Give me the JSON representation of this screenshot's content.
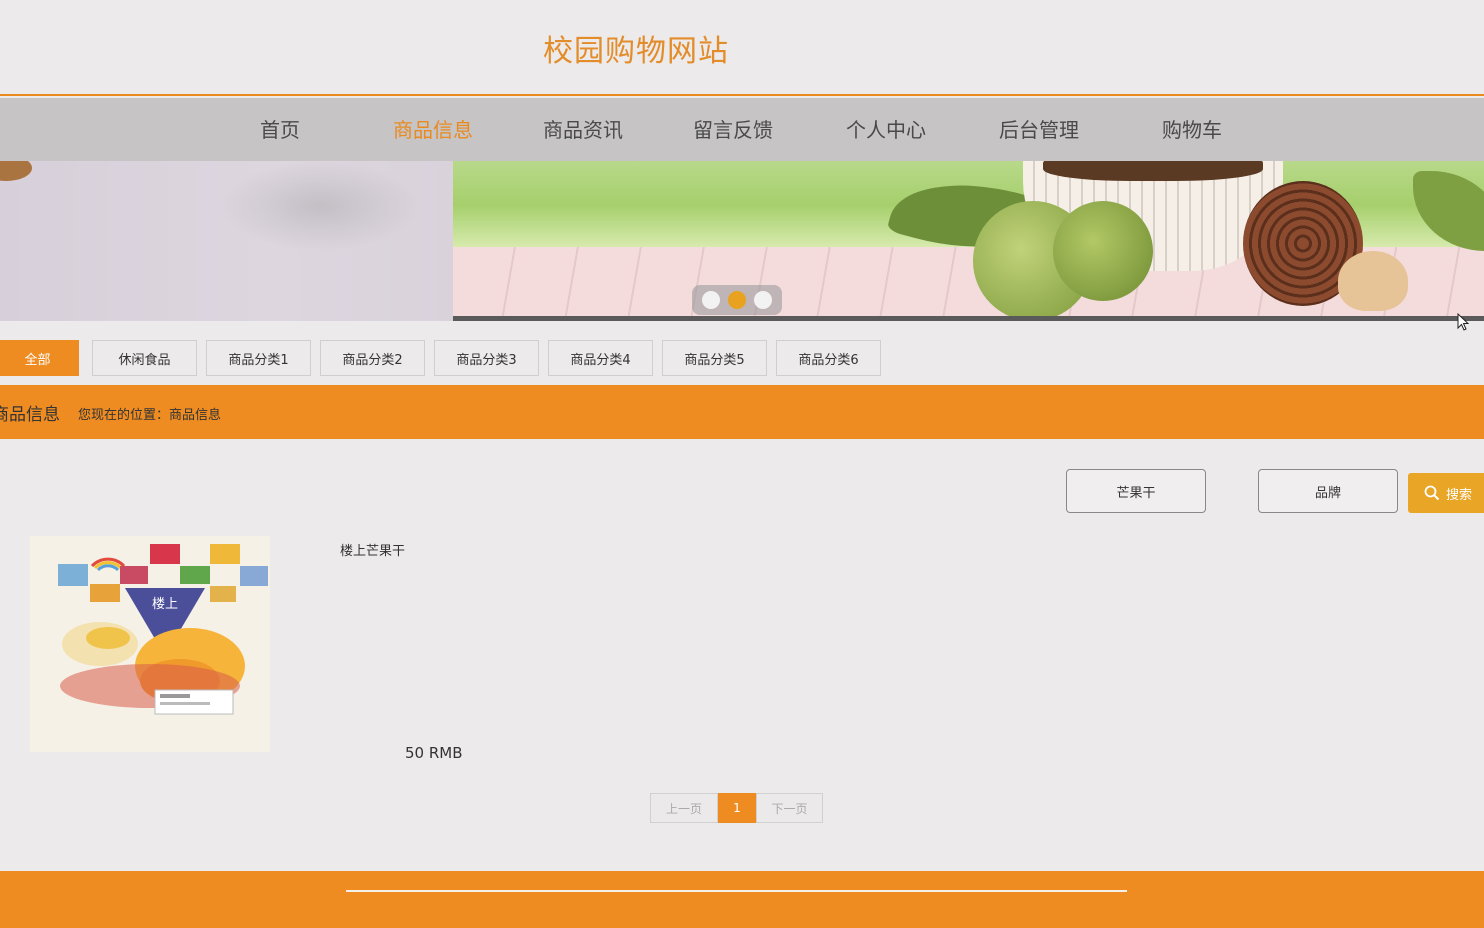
{
  "header": {
    "site_title": "校园购物网站"
  },
  "nav": {
    "items": [
      {
        "label": "首页"
      },
      {
        "label": "商品信息",
        "active": true
      },
      {
        "label": "商品资讯"
      },
      {
        "label": "留言反馈"
      },
      {
        "label": "个人中心"
      },
      {
        "label": "后台管理"
      },
      {
        "label": "购物车"
      }
    ]
  },
  "banner": {
    "dots": 3,
    "active_dot": 2
  },
  "categories": [
    {
      "label": "全部",
      "active": true
    },
    {
      "label": "休闲食品"
    },
    {
      "label": "商品分类1"
    },
    {
      "label": "商品分类2"
    },
    {
      "label": "商品分类3"
    },
    {
      "label": "商品分类4"
    },
    {
      "label": "商品分类5"
    },
    {
      "label": "商品分类6"
    }
  ],
  "crumbbar": {
    "title": "商品信息",
    "path": "您现在的位置：商品信息"
  },
  "search": {
    "name_value": "芒果干",
    "brand_value": "品牌",
    "button_label": "搜索"
  },
  "products": [
    {
      "name": "楼上芒果干",
      "price": "50 RMB",
      "package_text": "楼上"
    }
  ],
  "pager": {
    "prev": "上一页",
    "current": "1",
    "next": "下一页"
  },
  "colors": {
    "accent": "#ee8c22",
    "title": "#e38c2a",
    "nav_bg": "#c6c4c5",
    "button": "#e9a525"
  }
}
